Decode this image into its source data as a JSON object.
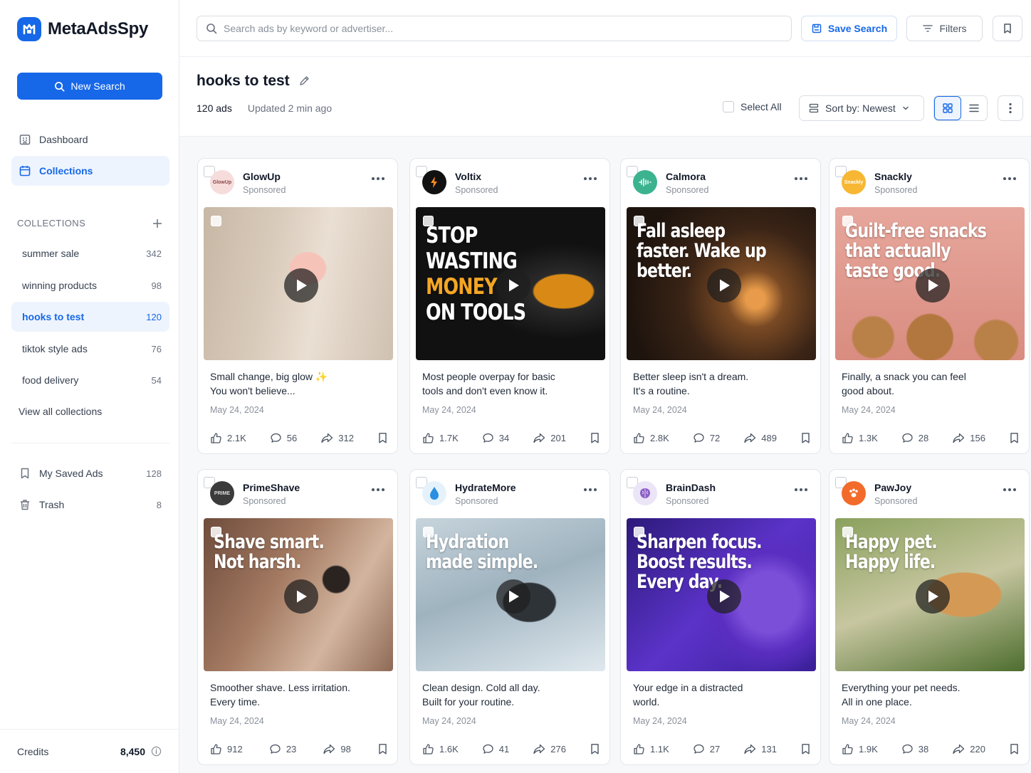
{
  "app": {
    "name": "MetaAdsSpy"
  },
  "sidebar": {
    "new_search": "New Search",
    "nav": [
      {
        "label": "Dashboard"
      },
      {
        "label": "Collections"
      }
    ],
    "collections_heading": "COLLECTIONS",
    "collections": [
      {
        "label": "summer sale",
        "count": "342"
      },
      {
        "label": "winning products",
        "count": "98"
      },
      {
        "label": "hooks to test",
        "count": "120"
      },
      {
        "label": "tiktok style ads",
        "count": "76"
      },
      {
        "label": "food delivery",
        "count": "54"
      }
    ],
    "view_all": "View all collections",
    "saved": [
      {
        "label": "My Saved Ads",
        "count": "128"
      },
      {
        "label": "Trash",
        "count": "8"
      }
    ],
    "credits_label": "Credits",
    "credits_value": "8,450"
  },
  "topbar": {
    "search_placeholder": "Search ads by keyword or advertiser...",
    "save_search": "Save Search",
    "filters": "Filters"
  },
  "header": {
    "title": "hooks to test",
    "ad_count": "120 ads",
    "updated": "Updated 2 min ago",
    "select_all": "Select All",
    "sort": "Sort by: Newest"
  },
  "colors": {
    "accent": "#1668e8",
    "accent_bg": "#eef4fe"
  },
  "cards": [
    {
      "advertiser": "GlowUp",
      "sponsored": "Sponsored",
      "avatar_text": "GlowUp",
      "headline": [],
      "caption1": "Small change, big glow ✨",
      "caption2": "You won't believe...",
      "date": "May 24, 2024",
      "likes": "2.1K",
      "comments": "56",
      "shares": "312"
    },
    {
      "advertiser": "Voltix",
      "sponsored": "Sponsored",
      "avatar_text": "",
      "headline": [
        "STOP",
        "WASTING",
        "MONEY",
        "ON TOOLS"
      ],
      "caption1": "Most people overpay for basic",
      "caption2": "tools and don't even know it.",
      "date": "May 24, 2024",
      "likes": "1.7K",
      "comments": "34",
      "shares": "201"
    },
    {
      "advertiser": "Calmora",
      "sponsored": "Sponsored",
      "avatar_text": "",
      "headline": [
        "Fall asleep",
        "faster. Wake up",
        "better."
      ],
      "caption1": "Better sleep isn't a dream.",
      "caption2": "It's a routine.",
      "date": "May 24, 2024",
      "likes": "2.8K",
      "comments": "72",
      "shares": "489"
    },
    {
      "advertiser": "Snackly",
      "sponsored": "Sponsored",
      "avatar_text": "Snackly",
      "headline": [
        "Guilt-free snacks",
        "that actually",
        "taste good."
      ],
      "caption1": "Finally, a snack you can feel",
      "caption2": "good about.",
      "date": "May 24, 2024",
      "likes": "1.3K",
      "comments": "28",
      "shares": "156"
    },
    {
      "advertiser": "PrimeShave",
      "sponsored": "Sponsored",
      "avatar_text": "PRIME",
      "headline": [
        "Shave smart.",
        "Not harsh."
      ],
      "caption1": "Smoother shave. Less irritation.",
      "caption2": "Every time.",
      "date": "May 24, 2024",
      "likes": "912",
      "comments": "23",
      "shares": "98"
    },
    {
      "advertiser": "HydrateMore",
      "sponsored": "Sponsored",
      "avatar_text": "",
      "headline": [
        "Hydration",
        "made simple."
      ],
      "caption1": "Clean design. Cold all day.",
      "caption2": "Built for your routine.",
      "date": "May 24, 2024",
      "likes": "1.6K",
      "comments": "41",
      "shares": "276"
    },
    {
      "advertiser": "BrainDash",
      "sponsored": "Sponsored",
      "avatar_text": "",
      "headline": [
        "Sharpen focus.",
        "Boost results.",
        "Every day."
      ],
      "caption1": "Your edge in a distracted",
      "caption2": "world.",
      "date": "May 24, 2024",
      "likes": "1.1K",
      "comments": "27",
      "shares": "131"
    },
    {
      "advertiser": "PawJoy",
      "sponsored": "Sponsored",
      "avatar_text": "",
      "headline": [
        "Happy pet.",
        "Happy life."
      ],
      "caption1": "Everything your pet needs.",
      "caption2": "All in one place.",
      "date": "May 24, 2024",
      "likes": "1.9K",
      "comments": "38",
      "shares": "220"
    }
  ]
}
